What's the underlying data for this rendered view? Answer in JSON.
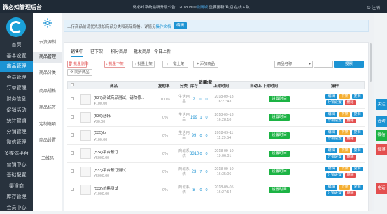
{
  "top": {
    "brand": "微必知管理后台",
    "notice_prefix": "微必知系统最新升级公告：20180810",
    "notice_link": "微商城",
    "notice_mid": "重要更新",
    "welcome": "欢迎 在线人数",
    "logout": "注销"
  },
  "sidebar": {
    "items": [
      "首页",
      "基本设置",
      "商品管理",
      "会员管理",
      "订单管理",
      "财务信息",
      "促销活动",
      "统计营销",
      "分销管理",
      "微信管理",
      "多媒体平台",
      "营销中心",
      "基础配置",
      "渠道商",
      "库存管理",
      "会员中心"
    ],
    "active_index": 2
  },
  "subsidebar": {
    "items": [
      "云资源制",
      "商品管理",
      "商品分类",
      "商品规格",
      "商品标签",
      "定制选项",
      "商品设置",
      "二维码"
    ],
    "active_index": 1
  },
  "banner": {
    "text_prefix": "上传商品前请优先添加商品分类和商品规格，详情见",
    "link": "操作文档",
    "button": "编辑"
  },
  "tabs": [
    "销售中",
    "已下架",
    "积分商品",
    "批发商品",
    "今日上新"
  ],
  "toolbar": {
    "delete": "批量删除",
    "offshelf": "批量下架",
    "batch_up": "批量上架",
    "up": "一键上架",
    "add": "添加商品",
    "sync": "同步商品",
    "select_value": "商品名称",
    "search": "搜索"
  },
  "columns": [
    "商品",
    "复购率",
    "分类",
    "库存",
    "销量",
    "收藏",
    "上架时间",
    "自动上/下架时间",
    "操作"
  ],
  "rows": [
    {
      "name": "(537)测试商品测试，请勿修...",
      "price": "¥100.00",
      "rate": "100%",
      "type": "生活用品",
      "stock": "2",
      "sales": "0",
      "fav": "0",
      "date": "2018-09-13",
      "time": "16:27:43",
      "auto": "设置时间"
    },
    {
      "name": "(536)涵韩",
      "price": "¥30.00",
      "rate": "0%",
      "type": "生活用品",
      "stock": "199",
      "sales": "1",
      "fav": "0",
      "date": "2018-09-13",
      "time": "16:28:10",
      "auto": "设置时间"
    },
    {
      "name": "(535)lol",
      "price": "¥100.00",
      "rate": "0%",
      "type": "生活用品",
      "stock": "99",
      "sales": "0",
      "fav": "0",
      "date": "2018-09-11",
      "time": "11:29:54",
      "auto": "设置时间"
    },
    {
      "name": "(534)平台预订",
      "price": "¥5000.00",
      "rate": "0%",
      "type": "商城系统",
      "stock": "3310",
      "sales": "0",
      "fav": "0",
      "date": "2018-09-10",
      "time": "19:06:01",
      "auto": "设置时间"
    },
    {
      "name": "(533)平台预订测试",
      "price": "¥5000.00",
      "rate": "0%",
      "type": "商城系统",
      "stock": "23",
      "sales": "7",
      "fav": "0",
      "date": "2018-09-10",
      "time": "16:35:06",
      "auto": "设置时间"
    },
    {
      "name": "(532)价格测试",
      "price": "¥1000.00",
      "rate": "0%",
      "type": "商城系统",
      "stock": "8",
      "sales": "0",
      "fav": "0",
      "date": "2018-09-05",
      "time": "16:27:54",
      "auto": "设置时间"
    }
  ],
  "ops": {
    "edit": "编辑",
    "offshelf": "下架",
    "copy": "复制",
    "share": "分销设置",
    "delete": "删除"
  },
  "float": [
    "关注",
    "咨询",
    "微信",
    "微博",
    "电话"
  ]
}
